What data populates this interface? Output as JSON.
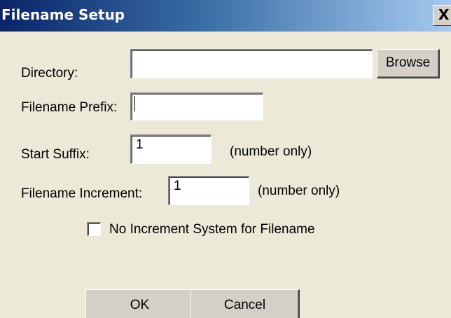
{
  "window": {
    "title": "Filename Setup",
    "close_glyph": "X"
  },
  "form": {
    "directory_label": "Directory:",
    "directory_value": "",
    "browse_label": "Browse",
    "prefix_label": "Filename Prefix:",
    "prefix_value": "",
    "start_suffix_label": "Start Suffix:",
    "start_suffix_value": "1",
    "start_suffix_hint": "(number only)",
    "increment_label": "Filename Increment:",
    "increment_value": "1",
    "increment_hint": "(number only)",
    "no_increment_label": "No Increment System for Filename",
    "no_increment_checked": false
  },
  "buttons": {
    "ok_label": "OK",
    "cancel_label": "Cancel"
  },
  "colors": {
    "title_gradient_start": "#0a246a",
    "title_gradient_end": "#a6caf0",
    "dialog_background": "#ece9d8"
  }
}
